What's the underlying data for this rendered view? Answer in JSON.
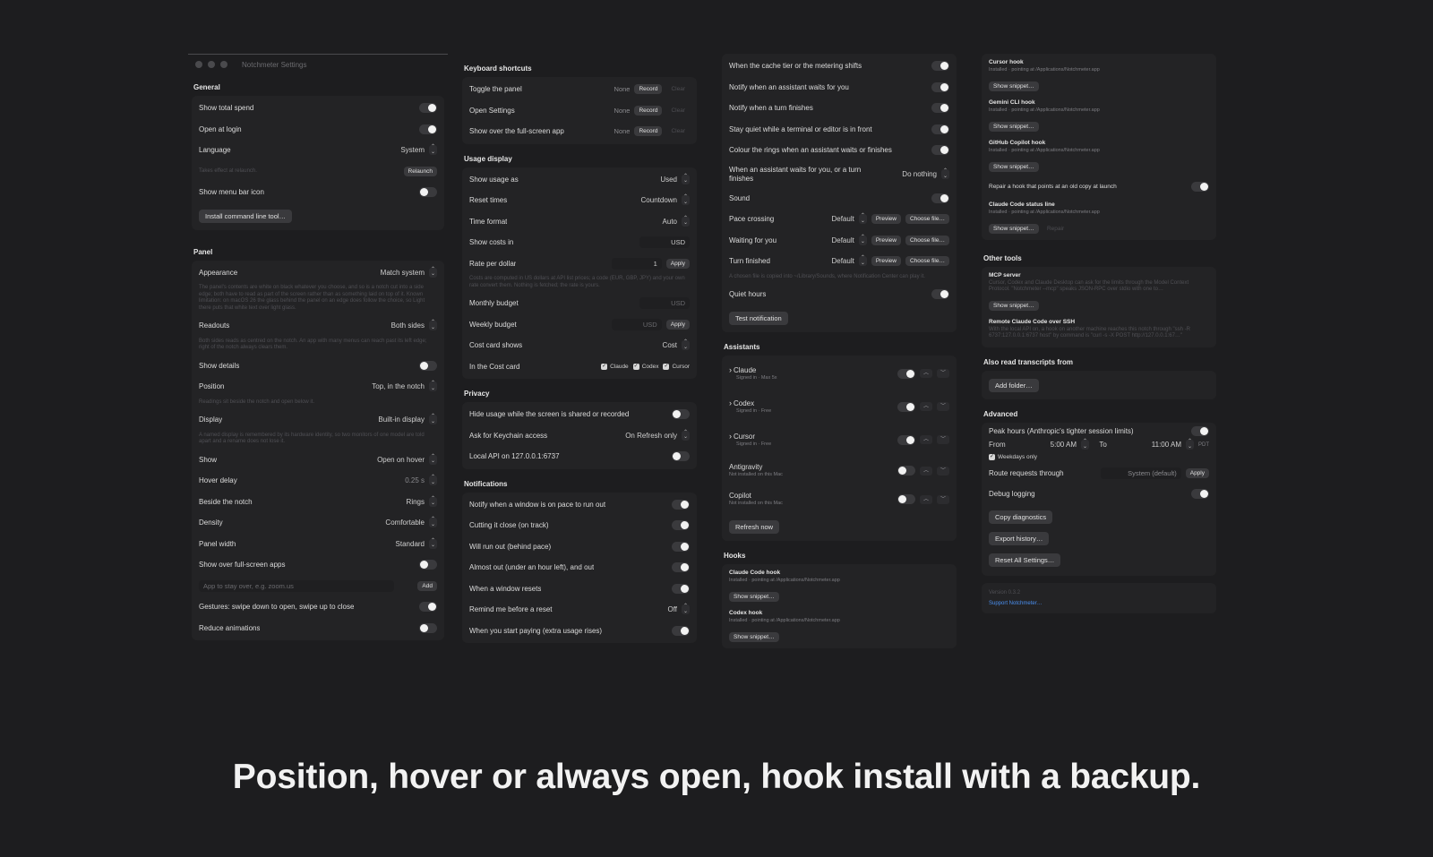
{
  "window": {
    "title": "Notchmeter Settings"
  },
  "caption": "Position, hover or always open, hook install with a backup.",
  "col1": {
    "general_h": "General",
    "show_total_spend": "Show total spend",
    "open_at_login": "Open at login",
    "language": "Language",
    "language_val": "System",
    "relaunch_note": "Takes effect at relaunch.",
    "relaunch_btn": "Relaunch",
    "show_menu_bar_icon": "Show menu bar icon",
    "install_cli_btn": "Install command line tool…",
    "panel_h": "Panel",
    "appearance": "Appearance",
    "appearance_val": "Match system",
    "appearance_note": "The panel's contents are white on black whatever you choose, and so is a notch cut into a side edge; both have to read as part of the screen rather than as something laid on top of it. Known limitation: on macOS 26 the glass behind the panel on an edge does follow the choice, so Light there puts that white text over light glass.",
    "readouts": "Readouts",
    "readouts_val": "Both sides",
    "readouts_note": "Both sides reads as centred on the notch. An app with many menus can reach past its left edge; right of the notch always clears them.",
    "show_details": "Show details",
    "position": "Position",
    "position_val": "Top, in the notch",
    "position_note": "Readings sit beside the notch and open below it.",
    "display": "Display",
    "display_val": "Built-in display",
    "display_note": "A named display is remembered by its hardware identity, so two monitors of one model are told apart and a rename does not lose it.",
    "show": "Show",
    "show_val": "Open on hover",
    "hover_delay": "Hover delay",
    "hover_delay_val": "0.25 s",
    "beside_notch": "Beside the notch",
    "beside_notch_val": "Rings",
    "density": "Density",
    "density_val": "Comfortable",
    "panel_width": "Panel width",
    "panel_width_val": "Standard",
    "show_over_fs": "Show over full-screen apps",
    "app_placeholder": "App to stay over, e.g. zoom.us",
    "add_btn": "Add",
    "gestures": "Gestures: swipe down to open, swipe up to close",
    "reduce_anim": "Reduce animations"
  },
  "col2": {
    "kb_h": "Keyboard shortcuts",
    "toggle_panel": "Toggle the panel",
    "open_settings": "Open Settings",
    "show_over_fs_app": "Show over the full-screen app",
    "none": "None",
    "record": "Record",
    "clear": "Clear",
    "usage_h": "Usage display",
    "show_usage_as": "Show usage as",
    "show_usage_as_val": "Used",
    "reset_times": "Reset times",
    "reset_times_val": "Countdown",
    "time_format": "Time format",
    "time_format_val": "Auto",
    "show_costs_in": "Show costs in",
    "show_costs_in_val": "USD",
    "rate_per_dollar": "Rate per dollar",
    "rate_val": "1",
    "apply": "Apply",
    "costs_note": "Costs are computed in US dollars at API list prices; a code (EUR, GBP, JPY) and your own rate convert them. Nothing is fetched; the rate is yours.",
    "monthly_budget": "Monthly budget",
    "monthly_val": "USD",
    "weekly_budget": "Weekly budget",
    "weekly_val": "USD",
    "cost_card_shows": "Cost card shows",
    "cost_card_val": "Cost",
    "in_cost_card": "In the Cost card",
    "chk_claude": "Claude",
    "chk_codex": "Codex",
    "chk_cursor": "Cursor",
    "privacy_h": "Privacy",
    "hide_usage": "Hide usage while the screen is shared or recorded",
    "keychain": "Ask for Keychain access",
    "keychain_val": "On Refresh only",
    "local_api": "Local API on 127.0.0.1:6737",
    "notif_h": "Notifications",
    "n1": "Notify when a window is on pace to run out",
    "n2": "Cutting it close (on track)",
    "n3": "Will run out (behind pace)",
    "n4": "Almost out (under an hour left), and out",
    "n5": "When a window resets",
    "n6": "Remind me before a reset",
    "n6_val": "Off",
    "n7": "When you start paying (extra usage rises)"
  },
  "col3": {
    "cache_tier": "When the cache tier or the metering shifts",
    "notify_waits": "Notify when an assistant waits for you",
    "notify_turn": "Notify when a turn finishes",
    "stay_quiet": "Stay quiet while a terminal or editor is in front",
    "colour_rings": "Colour the rings when an assistant waits or finishes",
    "when_waits": "When an assistant waits for you, or a turn finishes",
    "when_waits_val": "Do nothing",
    "sound": "Sound",
    "pace_crossing": "Pace crossing",
    "waiting_for_you": "Waiting for you",
    "turn_finished": "Turn finished",
    "default": "Default",
    "preview": "Preview",
    "choose_file": "Choose file…",
    "sound_note": "A chosen file is copied into ~/Library/Sounds, where Notification Center can play it.",
    "quiet_hours": "Quiet hours",
    "test_notif": "Test notification",
    "assistants_h": "Assistants",
    "a_claude": "Claude",
    "a_claude_sub": "Signed in · Max 5x",
    "a_codex": "Codex",
    "a_codex_sub": "Signed in · Free",
    "a_cursor": "Cursor",
    "a_cursor_sub": "Signed in · Free",
    "a_antigravity": "Antigravity",
    "a_antigravity_sub": "Not installed on this Mac",
    "a_copilot": "Copilot",
    "a_copilot_sub": "Not installed on this Mac",
    "refresh_now": "Refresh now",
    "hooks_h": "Hooks",
    "claude_hook": "Claude Code hook",
    "installed_path": "Installed · pointing at /Applications/Notchmeter.app",
    "show_snippet": "Show snippet…",
    "codex_hook": "Codex hook"
  },
  "col4": {
    "cursor_hook": "Cursor hook",
    "installed_path": "Installed · pointing at /Applications/Notchmeter.app",
    "show_snippet": "Show snippet…",
    "gemini_hook": "Gemini CLI hook",
    "copilot_hook": "GitHub Copilot hook",
    "repair_hook": "Repair a hook that points at an old copy at launch",
    "claude_status": "Claude Code status line",
    "repair": "Repair",
    "other_h": "Other tools",
    "mcp": "MCP server",
    "mcp_note": "Cursor, Codex and Claude Desktop can ask for the limits through the Model Context Protocol. \"Notchmeter --mcp\" speaks JSON-RPC over stdio with one to…",
    "remote": "Remote Claude Code over SSH",
    "remote_note": "With the local API on, a hook on another machine reaches this notch through \"ssh -R 6737:127.0.0.1:6737 host\" by command is \"curl -s -X POST http://127.0.0.1:67…\"",
    "also_h": "Also read transcripts from",
    "add_folder": "Add folder…",
    "adv_h": "Advanced",
    "peak": "Peak hours (Anthropic's tighter session limits)",
    "from": "From",
    "from_val": "5:00 AM",
    "to": "To",
    "to_val": "11:00 AM",
    "tz": "PDT",
    "weekdays": "Weekdays only",
    "route": "Route requests through",
    "route_val": "System (default)",
    "apply": "Apply",
    "debug": "Debug logging",
    "copy_diag": "Copy diagnostics",
    "export_hist": "Export history…",
    "reset_all": "Reset All Settings…",
    "version": "Version 0.3.2",
    "support": "Support Notchmeter…"
  }
}
